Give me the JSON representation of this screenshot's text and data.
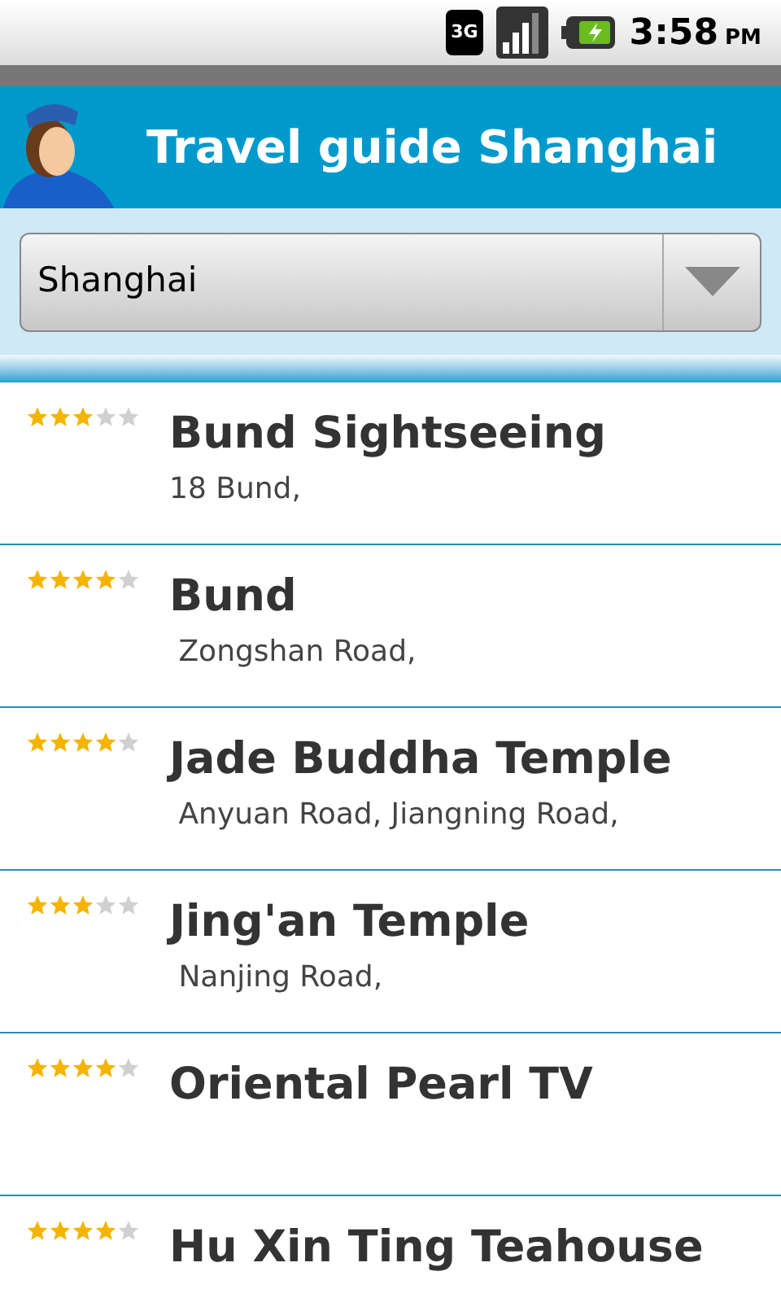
{
  "status_bar": {
    "network": "3G",
    "time": "3:58",
    "ampm": "PM"
  },
  "header": {
    "title": "Travel guide Shanghai"
  },
  "city_select": {
    "value": "Shanghai"
  },
  "places": [
    {
      "name": "Bund Sightseeing",
      "address": "18 Bund,",
      "stars": 3
    },
    {
      "name": "Bund",
      "address": " Zongshan Road,",
      "stars": 4
    },
    {
      "name": "Jade Buddha Temple",
      "address": " Anyuan Road, Jiangning Road,",
      "stars": 4
    },
    {
      "name": "Jing'an Temple",
      "address": " Nanjing Road,",
      "stars": 3
    },
    {
      "name": "Oriental Pearl TV",
      "stars": 4
    },
    {
      "name": "Hu Xin Ting Teahouse",
      "stars": 4
    }
  ]
}
